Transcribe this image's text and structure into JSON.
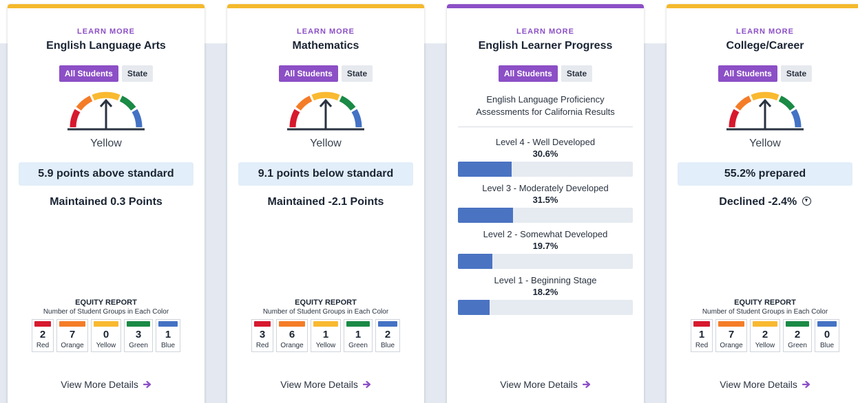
{
  "cards": [
    {
      "learn_more": "LEARN MORE",
      "title": "English Language Arts",
      "toggle": {
        "active": "All Students",
        "inactive": "State"
      },
      "color_word": "Yellow",
      "status": "5.9 points above standard",
      "change": "Maintained 0.3 Points",
      "equity": {
        "title": "EQUITY REPORT",
        "subtitle": "Number of Student Groups in Each Color",
        "items": [
          {
            "count": "2",
            "label": "Red",
            "color": "#d7192e"
          },
          {
            "count": "7",
            "label": "Orange",
            "color": "#f57c27"
          },
          {
            "count": "0",
            "label": "Yellow",
            "color": "#f9b930"
          },
          {
            "count": "3",
            "label": "Green",
            "color": "#1a8a45"
          },
          {
            "count": "1",
            "label": "Blue",
            "color": "#4472c4"
          }
        ]
      },
      "details": "View More Details"
    },
    {
      "learn_more": "LEARN MORE",
      "title": "Mathematics",
      "toggle": {
        "active": "All Students",
        "inactive": "State"
      },
      "color_word": "Yellow",
      "status": "9.1 points below standard",
      "change": "Maintained -2.1 Points",
      "equity": {
        "title": "EQUITY REPORT",
        "subtitle": "Number of Student Groups in Each Color",
        "items": [
          {
            "count": "3",
            "label": "Red",
            "color": "#d7192e"
          },
          {
            "count": "6",
            "label": "Orange",
            "color": "#f57c27"
          },
          {
            "count": "1",
            "label": "Yellow",
            "color": "#f9b930"
          },
          {
            "count": "1",
            "label": "Green",
            "color": "#1a8a45"
          },
          {
            "count": "2",
            "label": "Blue",
            "color": "#4472c4"
          }
        ]
      },
      "details": "View More Details"
    },
    {
      "learn_more": "LEARN MORE",
      "title": "English Learner Progress",
      "toggle": {
        "active": "All Students",
        "inactive": "State"
      },
      "subtitle": "English Language Proficiency Assessments for California Results",
      "levels": [
        {
          "name": "Level 4 - Well Developed",
          "pct": "30.6%",
          "value": 30.6
        },
        {
          "name": "Level 3 - Moderately Developed",
          "pct": "31.5%",
          "value": 31.5
        },
        {
          "name": "Level 2 - Somewhat Developed",
          "pct": "19.7%",
          "value": 19.7
        },
        {
          "name": "Level 1 - Beginning Stage",
          "pct": "18.2%",
          "value": 18.2
        }
      ],
      "details": "View More Details"
    },
    {
      "learn_more": "LEARN MORE",
      "title": "College/Career",
      "toggle": {
        "active": "All Students",
        "inactive": "State"
      },
      "color_word": "Yellow",
      "status": "55.2% prepared",
      "change": "Declined -2.4%",
      "equity": {
        "title": "EQUITY REPORT",
        "subtitle": "Number of Student Groups in Each Color",
        "items": [
          {
            "count": "1",
            "label": "Red",
            "color": "#d7192e"
          },
          {
            "count": "7",
            "label": "Orange",
            "color": "#f57c27"
          },
          {
            "count": "2",
            "label": "Yellow",
            "color": "#f9b930"
          },
          {
            "count": "2",
            "label": "Green",
            "color": "#1a8a45"
          },
          {
            "count": "0",
            "label": "Blue",
            "color": "#4472c4"
          }
        ]
      },
      "details": "View More Details"
    }
  ],
  "colors": {
    "accent_purple": "#8c4fc6",
    "top_border_yellow": "#f4b92c",
    "bar_blue": "#4a73c2",
    "gauge_red": "#d7192e",
    "gauge_orange": "#f57c27",
    "gauge_yellow": "#f9b930",
    "gauge_green": "#1a8a45",
    "gauge_blue": "#4472c4"
  },
  "icons": {
    "gauge": "gauge-icon",
    "arrow": "arrow-right-icon",
    "decline": "arrow-down-circle-icon"
  }
}
